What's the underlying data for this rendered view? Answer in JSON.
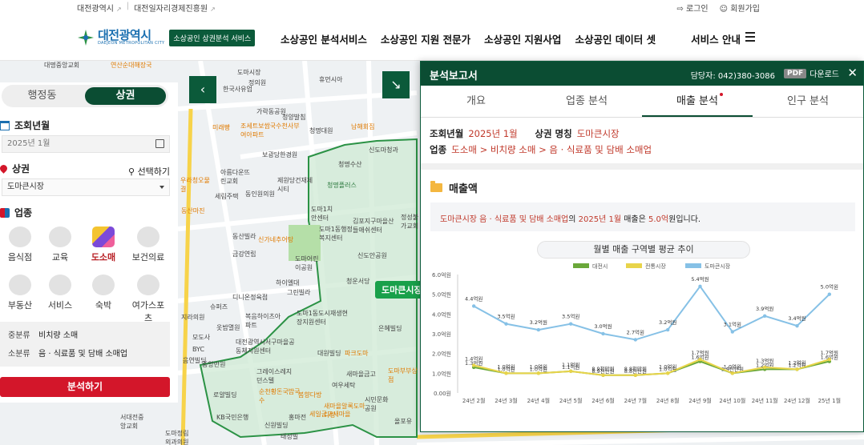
{
  "util": {
    "link1": "대전광역시",
    "link2": "대전일자리경제진흥원",
    "login": "로그인",
    "signup": "회원가입"
  },
  "header": {
    "logo_ko": "대전광역시",
    "logo_en": "DAEJEON METROPOLITAN CITY",
    "service_badge": "소상공인 상권분석 서비스",
    "nav": [
      "소상공인 분석서비스",
      "소상공인 지원 전문가",
      "소상공인 지원사업",
      "소상공인 데이터 셋",
      "서비스 안내"
    ]
  },
  "left": {
    "toggle": [
      "행정동",
      "상권"
    ],
    "period_title": "조회년월",
    "period_value": "2025년 1월",
    "area_title": "상권",
    "select_label": "선택하기",
    "area_value": "도마큰시장",
    "biz_title": "업종",
    "categories": [
      "음식점",
      "교육",
      "도소매",
      "보건의료",
      "부동산",
      "서비스",
      "숙박",
      "여가스포츠"
    ],
    "info": {
      "mid_key": "중분류",
      "mid_val": "비치량 소매",
      "sub_key": "소분류",
      "sub_val": "음 · 식료품 및 담배 소매업"
    },
    "analyze_btn": "분석하기"
  },
  "map": {
    "area_tag": "도마큰시장",
    "labels": [
      "대명중앙교회",
      "연산순대해장국",
      "도마시장",
      "정의원",
      "휴먼시아",
      "한국사유업",
      "청양발침",
      "미래빵",
      "가락동공원",
      "조세트보쌈국수천사부여아파트",
      "청명대원",
      "남해회집",
      "우라청오물결",
      "보광당한경원",
      "신도마청과",
      "청명수산",
      "청명플러스",
      "아름다운뜨린교회",
      "제원당건재제시티",
      "동인원의원",
      "세림주택",
      "동산마진",
      "동산빌라",
      "도마1치안센터",
      "도마1동행정복지센터",
      "김포지구마을산들애쉬센터",
      "정성불가교회",
      "신가네추어탕",
      "금강연립",
      "신도안공원",
      "도마어린이공원",
      "하이엘대",
      "그린빌라",
      "청운서당",
      "디니온정육점",
      "슈퍼즈",
      "지라의원",
      "복음하이츠아파트",
      "옷밤멸원",
      "모도사",
      "도마1동도시재생현장지원센터",
      "BYC",
      "대전광역시서구마을공동체지원센터",
      "음연빌딩",
      "대원빌딩",
      "파크도마",
      "그레이스레지던스텔",
      "중앙반원",
      "순천황돈국밥국수",
      "봄향다방",
      "로얄빌딩",
      "KB국민은행",
      "새마을금고",
      "여우세탁",
      "시민문화공원",
      "새마을알록도마다방",
      "신원빌딩",
      "서대전중앙교회",
      "도마정림외과의원",
      "홍마전",
      "올포유",
      "태성빌",
      "은혜빌딩",
      "도마부부상점",
      "세일금고새마을"
    ]
  },
  "report": {
    "title": "분석보고서",
    "contact": "담당자: 042)380-3086",
    "pdf_badge": "PDF",
    "download": "다운로드",
    "tabs": [
      "개요",
      "업종 분석",
      "매출 분석",
      "인구 분석"
    ],
    "meta": {
      "period_key": "조회년월",
      "period_val": "2025년 1월",
      "area_key": "상권 명칭",
      "area_val": "도마큰시장",
      "biz_key": "업종",
      "biz_val": "도소매 > 비치량 소매 > 음 · 식료품 및 담배 소매업"
    },
    "section_title": "매출액",
    "summary": {
      "pre": "도마큰시장 음 · 식료품 및 담배 소매업",
      "mid1": "의 ",
      "month": "2025년 1월",
      "mid2": " 매출은 ",
      "amount": "5.0억",
      "post": "원입니다."
    }
  },
  "chart_data": {
    "type": "line",
    "title": "월별 매출 구역별 평균 추이",
    "categories": [
      "24년 2월",
      "24년 3월",
      "24년 4월",
      "24년 5월",
      "24년 6월",
      "24년 7월",
      "24년 8월",
      "24년 9월",
      "24년 10월",
      "24년 11월",
      "24년 12월",
      "25년 1월"
    ],
    "ylim": [
      0,
      6.0
    ],
    "yticks": [
      "0.00원",
      "1.0억원",
      "2.0억원",
      "3.0억원",
      "4.0억원",
      "5.0억원",
      "6.0억원"
    ],
    "grid": false,
    "legend_position": "top",
    "series": [
      {
        "name": "대전시",
        "color": "#6aa83a",
        "values": [
          1.3,
          1.0,
          1.0,
          1.1,
          0.9,
          0.9,
          1.0,
          1.6,
          1.0,
          1.2,
          1.2,
          1.6
        ],
        "labels": [
          "1.3억원",
          "1.0억원",
          "1.0억원",
          "1.1억원",
          "8.9천만원",
          "8.8천만원",
          "1.0억원",
          "1.6억원",
          "9.9천만원",
          "1.2억원",
          "1.2억원",
          "1.6억원"
        ]
      },
      {
        "name": "전통시장",
        "color": "#e8d44a",
        "values": [
          1.4,
          1.0,
          1.0,
          1.1,
          0.9,
          0.9,
          1.0,
          1.7,
          1.0,
          1.3,
          1.2,
          1.7
        ],
        "labels": [
          "1.4억원",
          "1.0억원",
          "1.0억원",
          "1.1억원",
          "8.9천만원",
          "8.8천만원",
          "1.0억원",
          "1.7억원",
          "1.0억원",
          "1.3억원",
          "1.2억원",
          "1.7억원"
        ]
      },
      {
        "name": "도마큰시장",
        "color": "#86c1e6",
        "values": [
          4.4,
          3.5,
          3.2,
          3.5,
          3.0,
          2.7,
          3.2,
          5.4,
          3.1,
          3.9,
          3.4,
          5.0
        ],
        "labels": [
          "4.4억원",
          "3.5억원",
          "3.2억원",
          "3.5억원",
          "3.0억원",
          "2.7억원",
          "3.2억원",
          "5.4억원",
          "3.1억원",
          "3.9억원",
          "3.4억원",
          "5.0억원"
        ]
      }
    ]
  }
}
